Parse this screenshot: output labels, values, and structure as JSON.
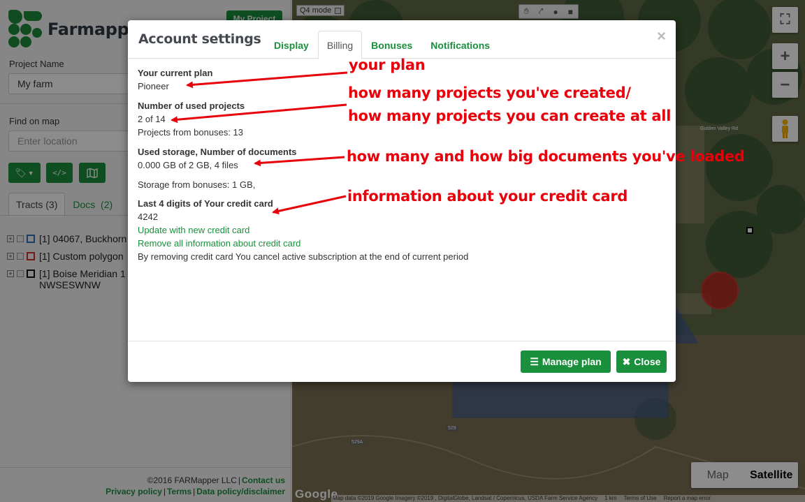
{
  "sidebar": {
    "logo_text": "Farmapper",
    "my_project_label": "My Project",
    "project_name_label": "Project Name",
    "project_name_value": "My farm",
    "find_on_map_label": "Find on map",
    "location_placeholder": "Enter location",
    "tabs": [
      {
        "label": "Tracts (3)"
      },
      {
        "label": "Docs  (2)"
      }
    ],
    "tracts": [
      {
        "text": "[1] 04067, Buckhorn",
        "color": "#2f6fb5"
      },
      {
        "text": "[1] Custom polygon",
        "color": "#d0312d"
      },
      {
        "text": "[1] Boise Meridian 1",
        "text2": "NWSESWNW",
        "color": "#111111"
      }
    ],
    "footer": {
      "copyright": "©2016 FARMapper LLC",
      "contact": "Contact us",
      "privacy": "Privacy policy",
      "terms": "Terms",
      "data_policy": "Data policy/disclaimer"
    }
  },
  "map": {
    "q4_label": "Q4 mode",
    "place_label": "Golden Valley Rd",
    "road_labels": [
      "529",
      "529A"
    ],
    "zoom_in": "+",
    "zoom_out": "−",
    "fullscreen": "⛶",
    "map_type_map": "Map",
    "map_type_satellite": "Satellite",
    "google": "Google",
    "attribution": "Map data ©2019 Google Imagery ©2019 , DigitalGlobe, Landsat / Copernicus, USDA Farm Service Agency",
    "scale": "1 km",
    "terms": "Terms of Use",
    "report": "Report a map error"
  },
  "modal": {
    "title": "Account settings",
    "tabs": [
      {
        "label": "Display"
      },
      {
        "label": "Billing"
      },
      {
        "label": "Bonuses"
      },
      {
        "label": "Notifications"
      }
    ],
    "close_x": "×",
    "plan_label": "Your current plan",
    "plan_value": "Pioneer",
    "projects_label": "Number of used projects",
    "projects_value": "2 of 14",
    "projects_bonus": "Projects from bonuses: 13",
    "storage_label": "Used storage, Number of documents",
    "storage_value": "0.000 GB of 2 GB, 4 files",
    "storage_bonus": "Storage from bonuses: 1 GB,",
    "card_label": "Last 4 digits of Your credit card",
    "card_value": "4242",
    "update_card": "Update with new credit card",
    "remove_card": "Remove all information about credit card",
    "remove_note": "By removing credit card You cancel active subscription at the end of current period",
    "manage_plan": "Manage plan",
    "close": "Close"
  },
  "annotations": {
    "plan": "your plan",
    "projects_1": "how many projects you've created/",
    "projects_2": "how many projects you can create at all",
    "storage": "how many and how big documents you've loaded",
    "card": "information about your credit card"
  },
  "colors": {
    "brand_green": "#1a8f3c",
    "annotation_red": "#e8000b"
  }
}
